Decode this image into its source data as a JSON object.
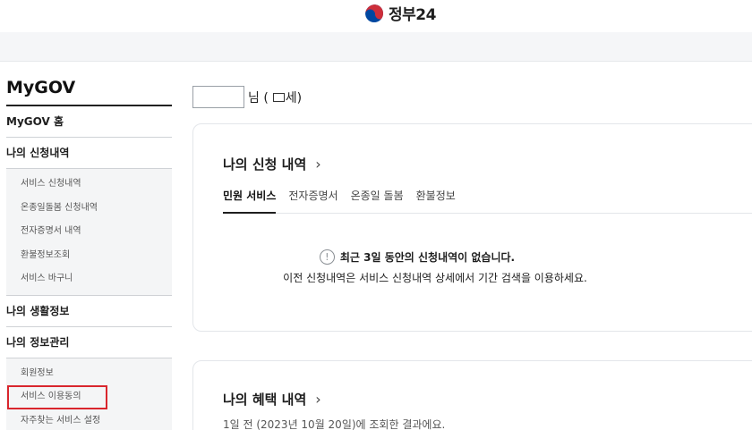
{
  "header": {
    "logo_text": "정부24",
    "logo_colors": {
      "red": "#cd2e3a",
      "blue": "#0047a0"
    }
  },
  "sidebar": {
    "title": "MyGOV",
    "home": "MyGOV 홈",
    "group1": "나의 신청내역",
    "group1_items": [
      "서비스 신청내역",
      "온종일돌봄 신청내역",
      "전자증명서 내역",
      "환불정보조회",
      "서비스 바구니"
    ],
    "group2": "나의 생활정보",
    "group3": "나의 정보관리",
    "group3_items": [
      "회원정보",
      "서비스 이용동의",
      "자주찾는 서비스 설정"
    ]
  },
  "greeting": {
    "suffix": "님 (",
    "age_suffix": "세)"
  },
  "card1": {
    "title": "나의 신청 내역",
    "tabs": [
      "민원 서비스",
      "전자증명서",
      "온종일 돌봄",
      "환불정보"
    ],
    "active_tab": "민원 서비스",
    "empty_line1": "최근 3일 동안의 신청내역이 없습니다.",
    "empty_line2": "이전 신청내역은 서비스 신청내역 상세에서 기간 검색을 이용하세요."
  },
  "card2": {
    "title": "나의 혜택 내역",
    "subtitle": "1일 전 (2023년 10월 20일)에 조회한 결과에요."
  }
}
